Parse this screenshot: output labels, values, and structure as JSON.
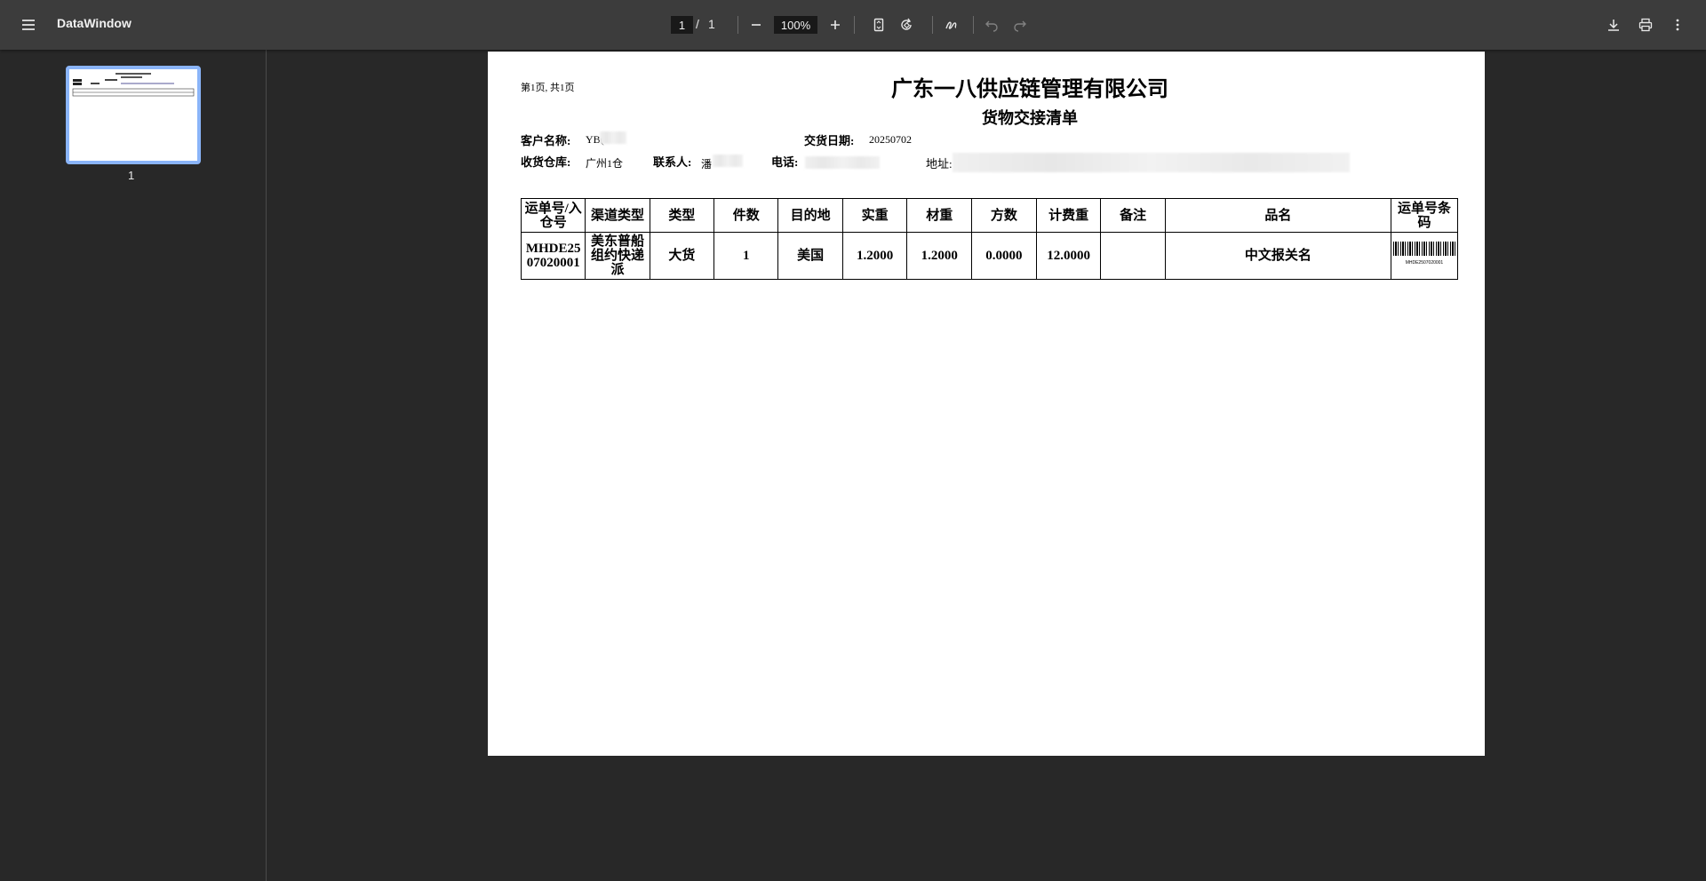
{
  "toolbar": {
    "title": "DataWindow",
    "current_page": "1",
    "page_separator": "/",
    "total_pages": "1",
    "zoom": "100%"
  },
  "sidebar": {
    "thumbnails": [
      {
        "label": "1"
      }
    ]
  },
  "document": {
    "page_info": "第1页, 共1页",
    "company": "广东一八供应链管理有限公司",
    "subtitle": "货物交接清单",
    "customer_label": "客户名称:",
    "customer_value": "YB(",
    "delivery_date_label": "交货日期:",
    "delivery_date_value": "20250702",
    "warehouse_label": "收货仓库:",
    "warehouse_value": "广州1仓",
    "contact_label": "联系人:",
    "contact_value": "潘",
    "phone_label": "电话:",
    "address_label": "地址:",
    "table": {
      "headers": [
        "运单号/入仓号",
        "渠道类型",
        "类型",
        "件数",
        "目的地",
        "实重",
        "材重",
        "方数",
        "计费重",
        "备注",
        "品名",
        "运单号条码"
      ],
      "rows": [
        {
          "waybill": "MHDE2507020001",
          "channel": "美东普船组约快递派",
          "type": "大货",
          "pieces": "1",
          "destination": "美国",
          "actual_weight": "1.2000",
          "volume_weight": "1.2000",
          "cbm": "0.0000",
          "billing_weight": "12.0000",
          "remarks": "",
          "product_name": "中文报关名",
          "barcode_text": "MHDE2507020001"
        }
      ]
    }
  }
}
